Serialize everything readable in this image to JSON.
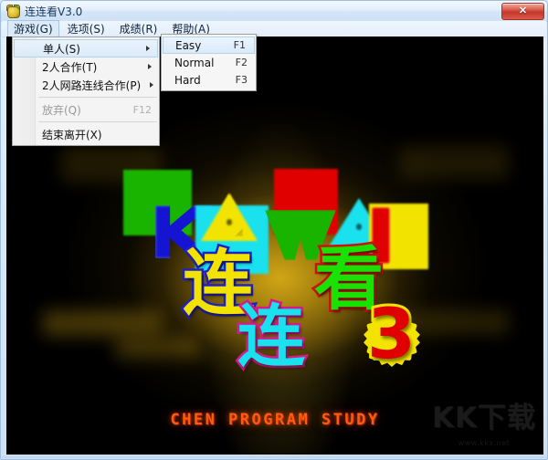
{
  "window": {
    "title": "连连看V3.0",
    "app_icon": "game-character-icon",
    "close_label": "✕"
  },
  "menubar": {
    "items": [
      {
        "label": "游戏(G)",
        "name": "menu-game",
        "active": true
      },
      {
        "label": "选项(S)",
        "name": "menu-options",
        "active": false
      },
      {
        "label": "成绩(R)",
        "name": "menu-scores",
        "active": false
      },
      {
        "label": "帮助(A)",
        "name": "menu-help",
        "active": false
      }
    ]
  },
  "game_menu": {
    "items": [
      {
        "label": "单人(S)",
        "accel": "",
        "submenu": true,
        "disabled": false,
        "highlight": true
      },
      {
        "label": "2人合作(T)",
        "accel": "",
        "submenu": true,
        "disabled": false,
        "highlight": false
      },
      {
        "label": "2人网路连线合作(P)",
        "accel": "",
        "submenu": true,
        "disabled": false,
        "highlight": false
      },
      {
        "label": "放弃(Q)",
        "accel": "F12",
        "submenu": false,
        "disabled": true,
        "highlight": false
      },
      {
        "label": "结束离开(X)",
        "accel": "",
        "submenu": false,
        "disabled": false,
        "highlight": false
      }
    ]
  },
  "difficulty_submenu": {
    "items": [
      {
        "label": "Easy",
        "accel": "F1",
        "highlight": true
      },
      {
        "label": "Normal",
        "accel": "F2",
        "highlight": false
      },
      {
        "label": "Hard",
        "accel": "F3",
        "highlight": false
      }
    ]
  },
  "splash": {
    "logo_letters": [
      "K",
      "A",
      "W",
      "A",
      "I"
    ],
    "title_cjk": [
      "连",
      "连",
      "看"
    ],
    "version_number": "3",
    "credit_text": "CHEN PROGRAM STUDY",
    "watermark_main": "KK下载",
    "watermark_sub": "www.kkx.net"
  },
  "colors": {
    "green": "#19b400",
    "blue": "#1414d2",
    "yellow": "#f2e400",
    "cyan": "#19e1ee",
    "red": "#e00000",
    "magenta": "#d61a8c",
    "orange": "#ff5a10",
    "gold_glow": "#d6aa16"
  }
}
